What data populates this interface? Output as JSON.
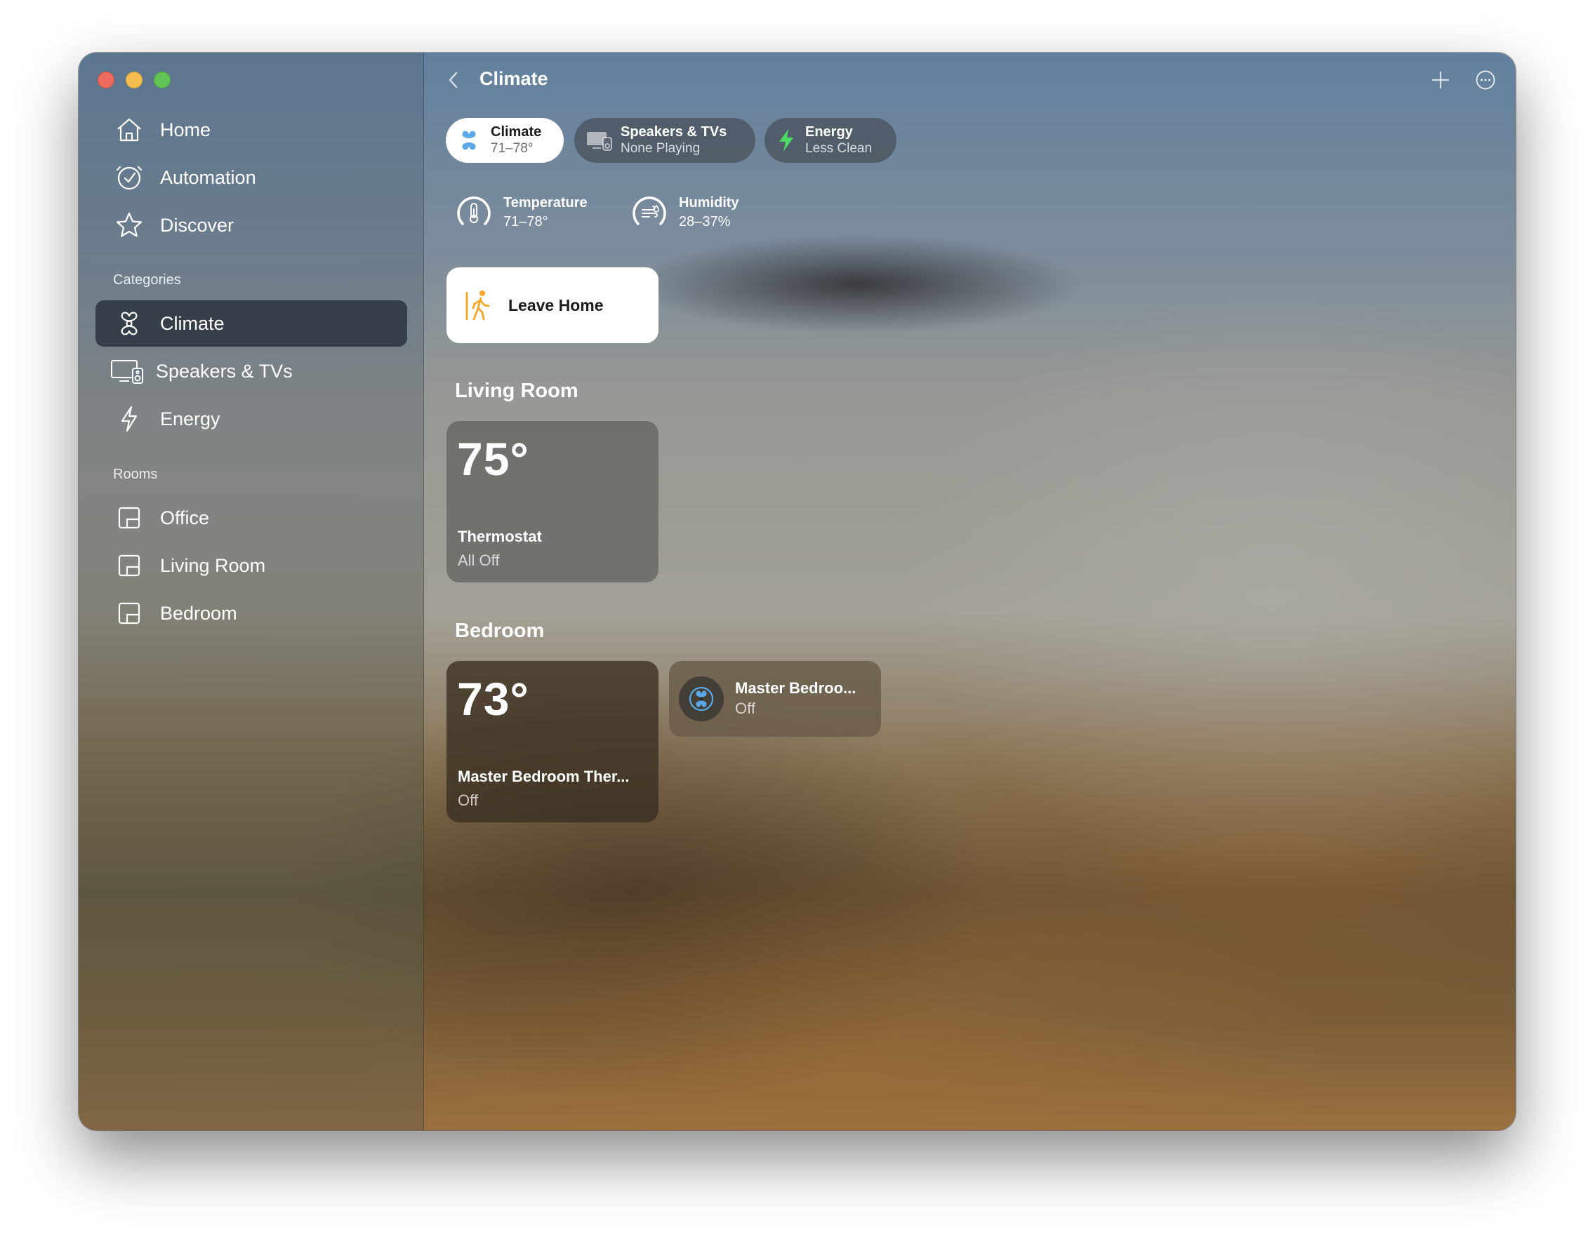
{
  "window": {
    "title": "Climate"
  },
  "sidebar": {
    "items": [
      {
        "label": "Home",
        "icon": "house-icon"
      },
      {
        "label": "Automation",
        "icon": "clock-check-icon"
      },
      {
        "label": "Discover",
        "icon": "star-icon"
      }
    ],
    "categories_title": "Categories",
    "categories": [
      {
        "label": "Climate",
        "icon": "fan-icon",
        "selected": true
      },
      {
        "label": "Speakers & TVs",
        "icon": "tv-speaker-icon",
        "selected": false
      },
      {
        "label": "Energy",
        "icon": "bolt-icon",
        "selected": false
      }
    ],
    "rooms_title": "Rooms",
    "rooms": [
      {
        "label": "Office",
        "icon": "room-icon"
      },
      {
        "label": "Living Room",
        "icon": "room-icon"
      },
      {
        "label": "Bedroom",
        "icon": "room-icon"
      }
    ]
  },
  "header": {
    "title": "Climate",
    "back_icon": "chevron-left-icon",
    "add_icon": "plus-icon",
    "more_icon": "ellipsis-circle-icon"
  },
  "chips": [
    {
      "title": "Climate",
      "subtitle": "71–78°",
      "icon": "fan-icon",
      "active": true
    },
    {
      "title": "Speakers & TVs",
      "subtitle": "None Playing",
      "icon": "tv-speaker-icon",
      "active": false
    },
    {
      "title": "Energy",
      "subtitle": "Less Clean",
      "icon": "bolt-icon",
      "active": false
    }
  ],
  "status": [
    {
      "title": "Temperature",
      "value": "71–78°",
      "icon": "thermometer-gauge-icon"
    },
    {
      "title": "Humidity",
      "value": "28–37%",
      "icon": "humidity-gauge-icon"
    }
  ],
  "scene": {
    "label": "Leave Home",
    "icon": "person-walking-icon"
  },
  "rooms": [
    {
      "name": "Living Room",
      "tiles": [
        {
          "temp": "75°",
          "name": "Thermostat",
          "status": "All Off"
        }
      ]
    },
    {
      "name": "Bedroom",
      "tiles": [
        {
          "temp": "73°",
          "name": "Master Bedroom Ther...",
          "status": "Off"
        }
      ],
      "accessories": [
        {
          "name": "Master Bedroo...",
          "status": "Off",
          "icon": "fan-icon"
        }
      ]
    }
  ],
  "colors": {
    "accent_blue": "#5aa9e6",
    "energy_green": "#4cd964",
    "scene_orange": "#f5a623",
    "selected_bg": "#28303a"
  }
}
